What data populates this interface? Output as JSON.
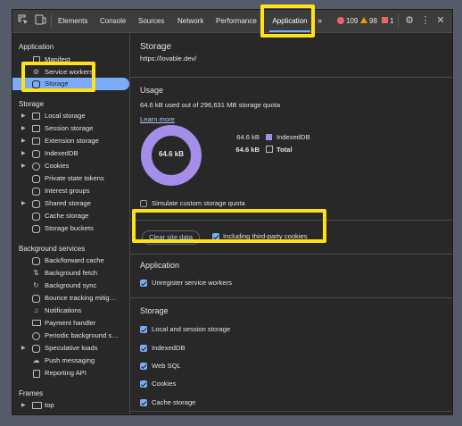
{
  "toolbar": {
    "tabs": [
      "Elements",
      "Console",
      "Sources",
      "Network",
      "Performance",
      "Application"
    ],
    "more_tabs": "»",
    "errors": "109",
    "warnings": "98",
    "issues": "1",
    "gear_icon": "gear-icon",
    "menu_icon": "⋮",
    "close_icon": "✕"
  },
  "sidebar": {
    "application_title": "Application",
    "application_items": [
      "Manifest",
      "Service workers",
      "Storage"
    ],
    "storage_title": "Storage",
    "storage_items": [
      "Local storage",
      "Session storage",
      "Extension storage",
      "IndexedDB",
      "Cookies",
      "Private state tokens",
      "Interest groups",
      "Shared storage",
      "Cache storage",
      "Storage buckets"
    ],
    "bg_title": "Background services",
    "bg_items": [
      "Back/forward cache",
      "Background fetch",
      "Background sync",
      "Bounce tracking mitig…",
      "Notifications",
      "Payment handler",
      "Periodic background s…",
      "Speculative loads",
      "Push messaging",
      "Reporting API"
    ],
    "frames_title": "Frames",
    "frames_items": [
      "top"
    ]
  },
  "main": {
    "title": "Storage",
    "origin": "https://lovable.dev/",
    "usage_title": "Usage",
    "usage_text": "64.6 kB used out of 296,631 MB storage quota",
    "learn_more": "Learn more",
    "donut_label": "64.6 kB",
    "legend": [
      {
        "value": "64.6 kB",
        "label": "IndexedDB"
      },
      {
        "value": "64.6 kB",
        "label": "Total"
      }
    ],
    "simulate_label": "Simulate custom storage quota",
    "clear_button": "Clear site data",
    "third_party_label": "Including third-party cookies",
    "application_section": "Application",
    "unregister_label": "Unregister service workers",
    "storage_section": "Storage",
    "storage_checks": [
      "Local and session storage",
      "IndexedDB",
      "Web SQL",
      "Cookies",
      "Cache storage"
    ]
  },
  "colors": {
    "accent": "#7cacf8",
    "donut": "#a58dea",
    "highlight": "#ffe11a",
    "background": "#282828"
  }
}
